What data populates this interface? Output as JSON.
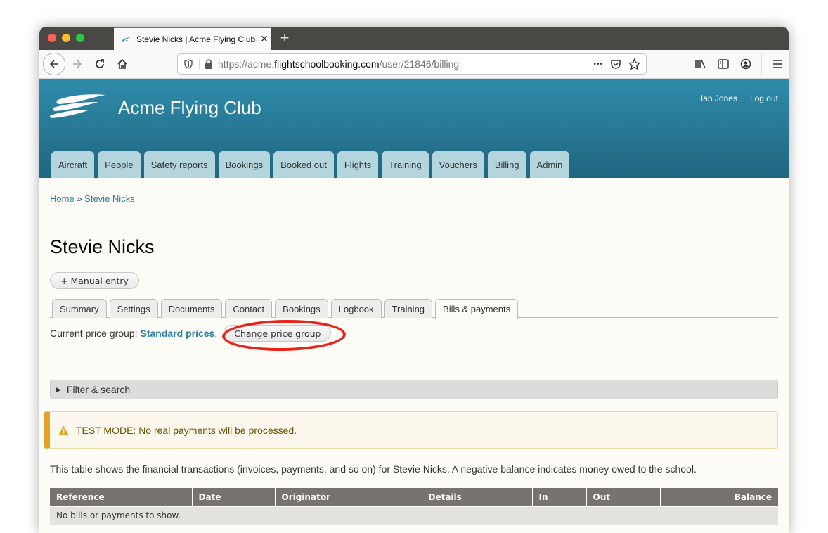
{
  "browser": {
    "tab_title": "Stevie Nicks | Acme Flying Club",
    "new_tab_label": "+",
    "url_prefix": "https://acme.",
    "url_host": "flightschoolbooking.com",
    "url_path": "/user/21846/billing",
    "more_label": "•••"
  },
  "site": {
    "name": "Acme Flying Club",
    "user_name": "Ian Jones",
    "logout_label": "Log out",
    "primary_tabs": [
      "Aircraft",
      "People",
      "Safety reports",
      "Bookings",
      "Booked out",
      "Flights",
      "Training",
      "Vouchers",
      "Billing",
      "Admin"
    ]
  },
  "breadcrumb": {
    "home": "Home",
    "separator": "»",
    "current": "Stevie Nicks"
  },
  "page": {
    "title": "Stevie Nicks",
    "manual_entry_label": "+ Manual entry",
    "secondary_tabs": [
      "Summary",
      "Settings",
      "Documents",
      "Contact",
      "Bookings",
      "Logbook",
      "Training",
      "Bills & payments"
    ],
    "active_tab": "Bills & payments",
    "price_group_label": "Current price group:",
    "price_group_value": "Standard prices",
    "price_group_period": ".",
    "change_price_group_label": "Change price group",
    "filter_label": "Filter & search",
    "alert_text": "TEST MODE: No real payments will be processed.",
    "description": "This table shows the financial transactions (invoices, payments, and so on) for Stevie Nicks. A negative balance indicates money owed to the school."
  },
  "table": {
    "columns": [
      "Reference",
      "Date",
      "Originator",
      "Details",
      "In",
      "Out",
      "Balance"
    ],
    "empty_message": "No bills or payments to show."
  },
  "colors": {
    "header_top": "#2f8bab",
    "header_bottom": "#1f6680",
    "tab_bg": "#b4d5dc",
    "link": "#2a7fa2",
    "highlight_ring": "#e8241b",
    "alert_accent": "#e2a227"
  }
}
